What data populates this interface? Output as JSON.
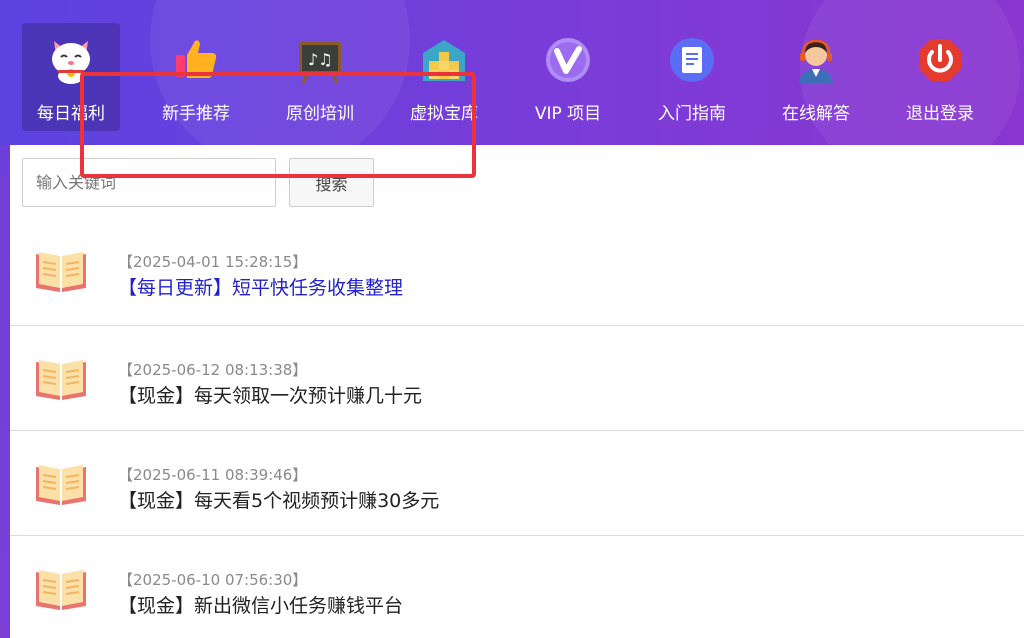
{
  "nav": {
    "items": [
      {
        "label": "每日福利",
        "icon": "lucky-cat-icon",
        "active": true
      },
      {
        "label": "新手推荐",
        "icon": "thumbs-up-icon",
        "active": false
      },
      {
        "label": "原创培训",
        "icon": "blackboard-icon",
        "active": false
      },
      {
        "label": "虚拟宝库",
        "icon": "warehouse-icon",
        "active": false
      },
      {
        "label": "VIP 项目",
        "icon": "vip-icon",
        "active": false
      },
      {
        "label": "入门指南",
        "icon": "document-icon",
        "active": false
      },
      {
        "label": "在线解答",
        "icon": "support-agent-icon",
        "active": false
      },
      {
        "label": "退出登录",
        "icon": "power-icon",
        "active": false
      }
    ]
  },
  "search": {
    "placeholder": "输入关键词",
    "button_label": "搜索"
  },
  "articles": [
    {
      "date": "【2025-04-01 15:28:15】",
      "title": "【每日更新】短平快任务收集整理",
      "highlighted": true
    },
    {
      "date": "【2025-06-12 08:13:38】",
      "title": "【现金】每天领取一次预计赚几十元",
      "highlighted": false
    },
    {
      "date": "【2025-06-11 08:39:46】",
      "title": "【现金】每天看5个视频预计赚30多元",
      "highlighted": false
    },
    {
      "date": "【2025-06-10 07:56:30】",
      "title": "【现金】新出微信小任务赚钱平台",
      "highlighted": false
    }
  ],
  "colors": {
    "header_start": "#5b43e0",
    "header_end": "#8a36d0",
    "link": "#2222cc",
    "highlight_border": "#e8343a"
  }
}
